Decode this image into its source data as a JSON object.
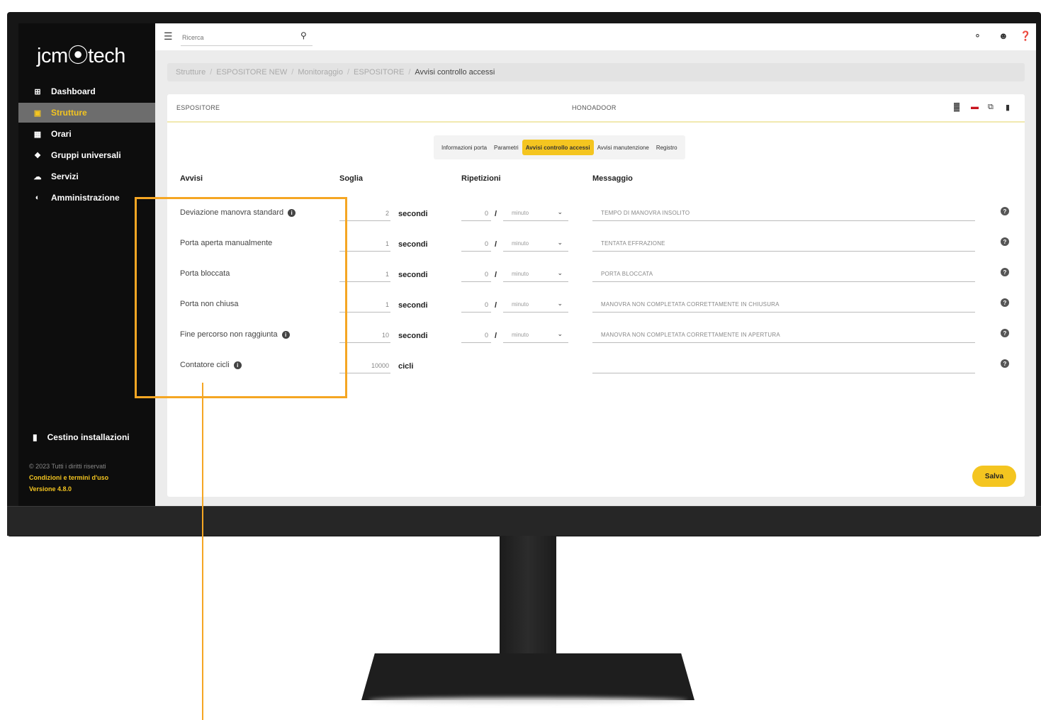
{
  "app": {
    "logo": "jcm⦿tech"
  },
  "sidebar": {
    "items": [
      {
        "label": "Dashboard",
        "icon": "dashboard-icon",
        "glyph": "⊞"
      },
      {
        "label": "Strutture",
        "icon": "building-icon",
        "glyph": "▣",
        "active": true
      },
      {
        "label": "Orari",
        "icon": "calendar-icon",
        "glyph": "▦"
      },
      {
        "label": "Gruppi universali",
        "icon": "users-icon",
        "glyph": "❖"
      },
      {
        "label": "Servizi",
        "icon": "cloud-icon",
        "glyph": "☁"
      },
      {
        "label": "Amministrazione",
        "icon": "admin-icon",
        "glyph": "◐"
      }
    ],
    "trash_label": "Cestino installazioni",
    "copyright": "© 2023 Tutti i diritti riservati",
    "terms": "Condizioni e termini d'uso",
    "version": "Versione 4.8.0"
  },
  "topbar": {
    "search_placeholder": "Ricerca"
  },
  "breadcrumb": [
    "Strutture",
    "ESPOSITORE NEW",
    "Monitoraggio",
    "ESPOSITORE",
    "Avvisi controllo accessi"
  ],
  "card": {
    "title": "ESPOSITORE",
    "subtitle": "HONOADOOR"
  },
  "tabs": [
    "Informazioni porta",
    "Parametri",
    "Avvisi controllo accessi",
    "Avvisi manutenzione",
    "Registro"
  ],
  "active_tab": "Avvisi controllo accessi",
  "columns": {
    "avvisi": "Avvisi",
    "soglia": "Soglia",
    "ripetizioni": "Ripetizioni",
    "messaggio": "Messaggio"
  },
  "rows": [
    {
      "label": "Deviazione manovra standard",
      "info": true,
      "threshold": "2",
      "unit": "secondi",
      "repetitions": "0",
      "interval": "minuto",
      "message": "TEMPO DI MANOVRA INSOLITO"
    },
    {
      "label": "Porta aperta manualmente",
      "info": false,
      "threshold": "1",
      "unit": "secondi",
      "repetitions": "0",
      "interval": "minuto",
      "message": "TENTATA EFFRAZIONE"
    },
    {
      "label": "Porta bloccata",
      "info": false,
      "threshold": "1",
      "unit": "secondi",
      "repetitions": "0",
      "interval": "minuto",
      "message": "PORTA BLOCCATA"
    },
    {
      "label": "Porta non chiusa",
      "info": false,
      "threshold": "1",
      "unit": "secondi",
      "repetitions": "0",
      "interval": "minuto",
      "message": "MANOVRA NON COMPLETATA CORRETTAMENTE IN CHIUSURA"
    },
    {
      "label": "Fine percorso non raggiunta",
      "info": true,
      "threshold": "10",
      "unit": "secondi",
      "repetitions": "0",
      "interval": "minuto",
      "message": "MANOVRA NON COMPLETATA CORRETTAMENTE IN APERTURA"
    },
    {
      "label": "Contatore cicli",
      "info": true,
      "threshold": "10000",
      "unit": "cicli",
      "message": ""
    }
  ],
  "save_label": "Salva",
  "colors": {
    "accent": "#f4c520",
    "sidebar": "#0d0d0d",
    "highlight": "#f5a623"
  }
}
